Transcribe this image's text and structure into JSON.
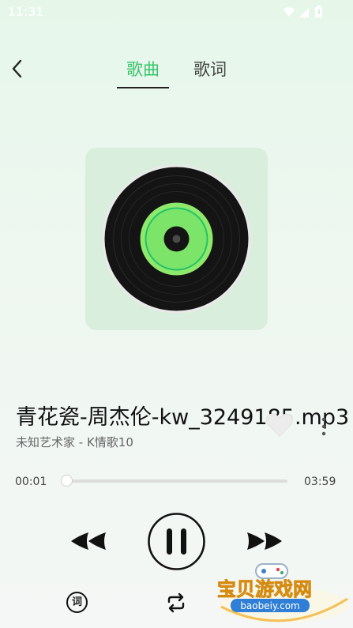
{
  "status_bar": {
    "time": "11:31"
  },
  "header": {
    "tabs": [
      {
        "label": "歌曲",
        "active": true
      },
      {
        "label": "歌词",
        "active": false
      }
    ]
  },
  "song": {
    "title": "青花瓷-周杰伦-kw_3249185.mp3",
    "artist": "未知艺术家 - K情歌10"
  },
  "progress": {
    "current": "00:01",
    "total": "03:59",
    "fraction": 0.004
  },
  "controls": {
    "lyrics_icon_label": "词"
  },
  "watermark": {
    "name": "宝贝游戏网",
    "url": "baobeiy.com"
  },
  "colors": {
    "accent": "#36c46a",
    "disc_green": "#8ee86a",
    "cover_bg": "#d9eedd"
  },
  "icons": [
    "back-arrow-icon",
    "wifi-icon",
    "signal-icon",
    "battery-icon",
    "vinyl-disc-icon",
    "heart-icon",
    "more-vertical-icon",
    "previous-icon",
    "pause-icon",
    "next-icon",
    "lyrics-icon",
    "repeat-icon"
  ]
}
